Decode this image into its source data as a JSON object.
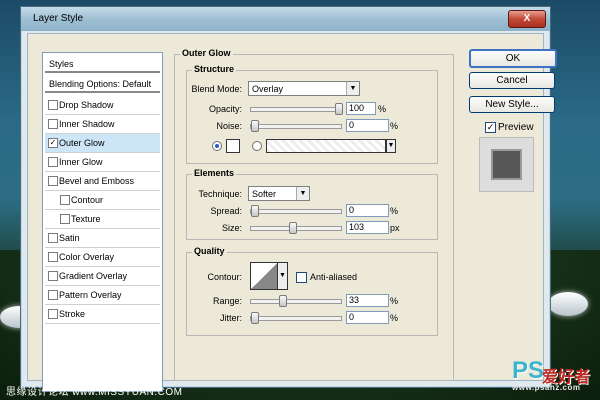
{
  "window": {
    "title": "Layer Style",
    "close_glyph": "X"
  },
  "styles_list": {
    "items": [
      {
        "label": "Styles",
        "kind": "header"
      },
      {
        "label": "Blending Options: Default",
        "kind": "header"
      },
      {
        "label": "Drop Shadow",
        "checked": false
      },
      {
        "label": "Inner Shadow",
        "checked": false
      },
      {
        "label": "Outer Glow",
        "checked": true,
        "selected": true
      },
      {
        "label": "Inner Glow",
        "checked": false
      },
      {
        "label": "Bevel and Emboss",
        "checked": false
      },
      {
        "label": "Contour",
        "checked": false,
        "sub": true
      },
      {
        "label": "Texture",
        "checked": false,
        "sub": true
      },
      {
        "label": "Satin",
        "checked": false
      },
      {
        "label": "Color Overlay",
        "checked": false
      },
      {
        "label": "Gradient Overlay",
        "checked": false
      },
      {
        "label": "Pattern Overlay",
        "checked": false
      },
      {
        "label": "Stroke",
        "checked": false
      }
    ]
  },
  "outer_glow": {
    "title": "Outer Glow",
    "structure": {
      "title": "Structure",
      "blend_mode_label": "Blend Mode:",
      "blend_mode_value": "Overlay",
      "opacity_label": "Opacity:",
      "opacity_value": "100",
      "opacity_unit": "%",
      "noise_label": "Noise:",
      "noise_value": "0",
      "noise_unit": "%"
    },
    "elements": {
      "title": "Elements",
      "technique_label": "Technique:",
      "technique_value": "Softer",
      "spread_label": "Spread:",
      "spread_value": "0",
      "spread_unit": "%",
      "size_label": "Size:",
      "size_value": "103",
      "size_unit": "px"
    },
    "quality": {
      "title": "Quality",
      "contour_label": "Contour:",
      "anti_aliased_label": "Anti-aliased",
      "range_label": "Range:",
      "range_value": "33",
      "range_unit": "%",
      "jitter_label": "Jitter:",
      "jitter_value": "0",
      "jitter_unit": "%"
    }
  },
  "buttons": {
    "ok": "OK",
    "cancel": "Cancel",
    "new_style": "New Style..."
  },
  "preview": {
    "label": "Preview",
    "checked": true,
    "check_glyph": "✓"
  },
  "watermark": {
    "left_text": "思缘设计论坛 www.MISSYUAN.COM",
    "logo_ps": "PS",
    "logo_cn": "爱好者",
    "logo_url": "www.psahz.com"
  }
}
